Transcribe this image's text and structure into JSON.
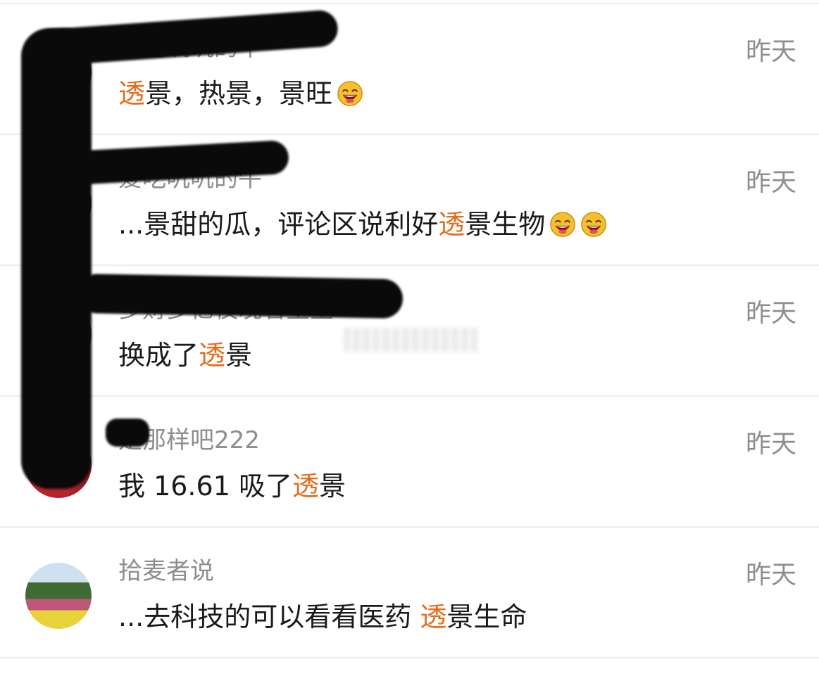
{
  "comments": [
    {
      "name": "爱吃叽叽的牛",
      "time": "昨天",
      "segments": [
        "",
        "透",
        "景，热景，景旺"
      ],
      "emoji_count": 1
    },
    {
      "name": "爱吃叽叽的牛",
      "time": "昨天",
      "segments": [
        "...景甜的瓜，评论区说利好",
        "透",
        "景生物"
      ],
      "emoji_count": 2
    },
    {
      "name": "多财多亿夜晚看星星",
      "time": "昨天",
      "segments": [
        "换成了",
        "透",
        "景"
      ],
      "emoji_count": 0
    },
    {
      "name": "是那样吧222",
      "time": "昨天",
      "segments": [
        "我 16.61 吸了",
        "透",
        "景"
      ],
      "emoji_count": 0
    },
    {
      "name": "拾麦者说",
      "time": "昨天",
      "segments": [
        "...去科技的可以看看医药 ",
        "透",
        "景生命"
      ],
      "emoji_count": 0
    }
  ],
  "icons": {
    "emoji": "grinning-face-icon"
  },
  "colors": {
    "highlight": "#e46d1b",
    "secondary_text": "#8e8e8e",
    "primary_text": "#1a1a1a",
    "redaction": "#0a0a0a"
  }
}
